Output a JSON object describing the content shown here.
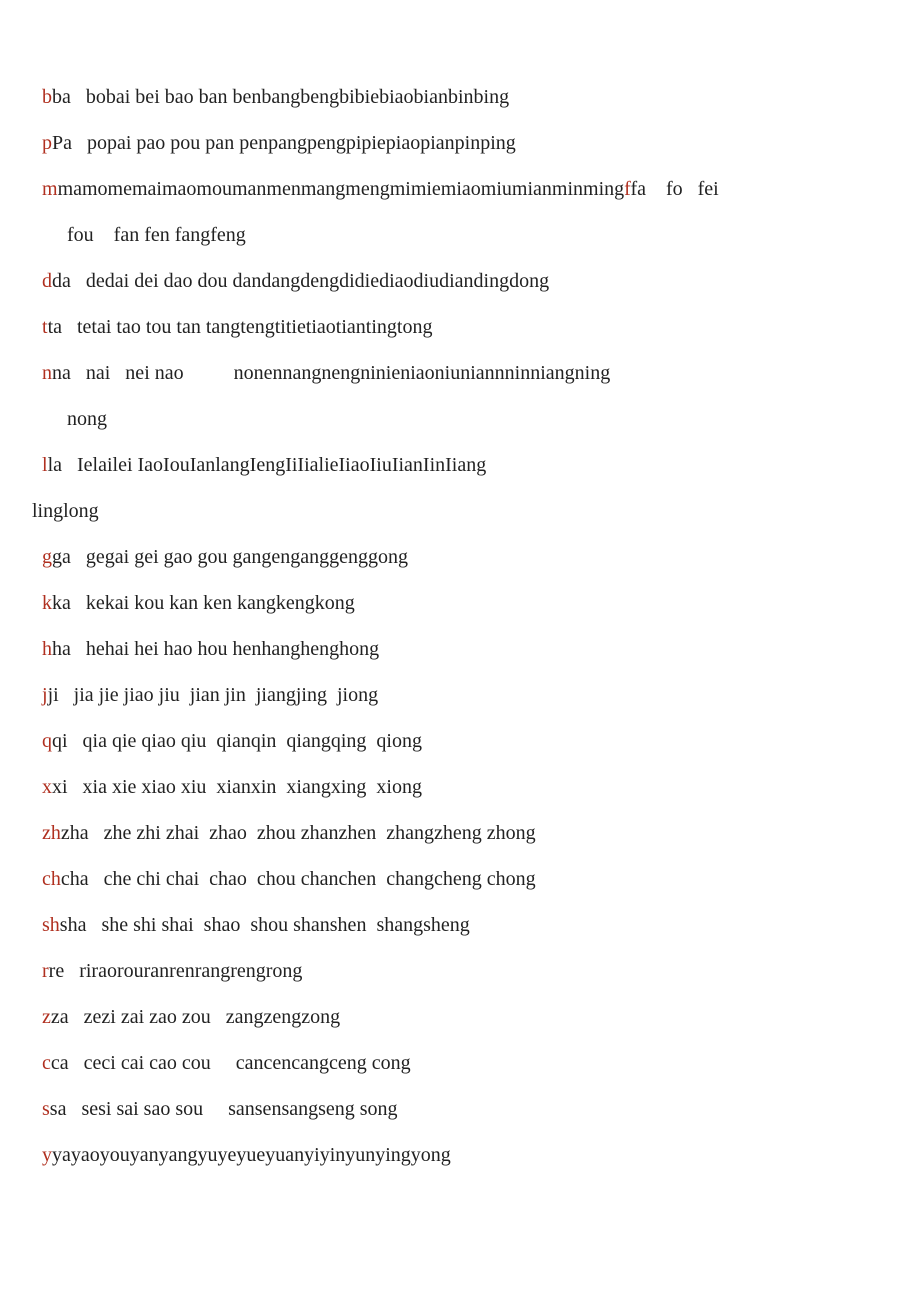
{
  "rows": [
    {
      "indent": "  ",
      "initial": "b",
      "rest": "ba   bobai bei bao ban benbangbengbibiebiaobianbinbing"
    },
    {
      "indent": "  ",
      "initial": "p",
      "rest": "Pa   popai pao pou pan penpangpengpipiepiaopianpinping"
    },
    {
      "indent": "  ",
      "initial": "m",
      "rest": "mamomemaimaomoumanmenmangmengmimiemiaomiumianminming",
      "tail_initial": "f",
      "tail_rest": "fa    fo   fei"
    },
    {
      "indent": "       ",
      "initial": "",
      "rest": "fou    fan fen fangfeng"
    },
    {
      "indent": "  ",
      "initial": "d",
      "rest": "da   dedai dei dao dou dandangdengdidiediaodiudiandingdong"
    },
    {
      "indent": "  ",
      "initial": "t",
      "rest": "ta   tetai tao tou tan tangtengtitietiaotiantingtong"
    },
    {
      "indent": "  ",
      "initial": "n",
      "rest": "na   nai   nei nao          nonennangnengninieniaoniuniannninniangning"
    },
    {
      "indent": "       ",
      "initial": "",
      "rest": "nong"
    },
    {
      "indent": "  ",
      "initial": "l",
      "rest": "la   Ielailei IaoIouIanlangIengIiIialieIiaoIiuIianIinIiang"
    },
    {
      "indent": "",
      "initial": "",
      "rest": "linglong"
    },
    {
      "indent": "  ",
      "initial": "g",
      "rest": "ga   gegai gei gao gou gangenganggenggong"
    },
    {
      "indent": "  ",
      "initial": "k",
      "rest": "ka   kekai kou kan ken kangkengkong"
    },
    {
      "indent": "  ",
      "initial": "h",
      "rest": "ha   hehai hei hao hou henhanghenghong"
    },
    {
      "indent": "  ",
      "initial": "j",
      "rest": "ji   jia jie jiao jiu  jian jin  jiangjing  jiong"
    },
    {
      "indent": "  ",
      "initial": "q",
      "rest": "qi   qia qie qiao qiu  qianqin  qiangqing  qiong"
    },
    {
      "indent": "  ",
      "initial": "x",
      "rest": "xi   xia xie xiao xiu  xianxin  xiangxing  xiong"
    },
    {
      "indent": "  ",
      "initial": "zh",
      "rest": "zha   zhe zhi zhai  zhao  zhou zhanzhen  zhangzheng zhong"
    },
    {
      "indent": "  ",
      "initial": "ch",
      "rest": "cha   che chi chai  chao  chou chanchen  changcheng chong"
    },
    {
      "indent": "  ",
      "initial": "sh",
      "rest": "sha   she shi shai  shao  shou shanshen  shangsheng"
    },
    {
      "indent": "  ",
      "initial": "r",
      "rest": "re   riraorouranrenrangrengrong"
    },
    {
      "indent": "  ",
      "initial": "z",
      "rest": "za   zezi zai zao zou   zangzengzong"
    },
    {
      "indent": "  ",
      "initial": "c",
      "rest": "ca   ceci cai cao cou     cancencangceng cong"
    },
    {
      "indent": "  ",
      "initial": "s",
      "rest": "sa   sesi sai sao sou     sansensangseng song"
    },
    {
      "indent": "  ",
      "initial": "y",
      "rest": "yayaoyouyanyangyuyeyueyuanyiyinyunyingyong"
    }
  ]
}
